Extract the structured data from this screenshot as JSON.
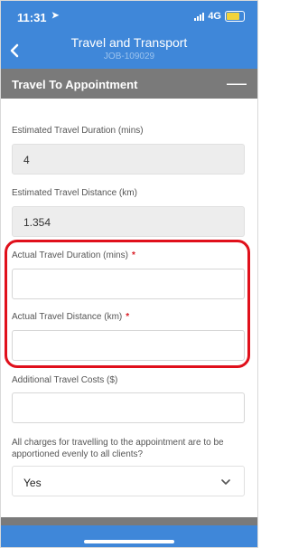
{
  "status_bar": {
    "time": "11:31",
    "network": "4G"
  },
  "header": {
    "title": "Travel and Transport",
    "subtitle": "JOB-109029",
    "back_icon": "chevron-left-icon"
  },
  "section": {
    "title": "Travel To Appointment",
    "collapse_icon": "minus-icon"
  },
  "fields": {
    "est_duration_label": "Estimated Travel Duration (mins)",
    "est_duration_value": "4",
    "est_distance_label": "Estimated Travel Distance (km)",
    "est_distance_value": "1.354",
    "actual_duration_label": "Actual Travel Duration (mins)",
    "actual_distance_label": "Actual Travel Distance (km)",
    "required_mark": "*",
    "additional_costs_label": "Additional Travel Costs ($)",
    "apportion_question": "All charges for travelling to the appointment are to be apportioned evenly to all clients?",
    "apportion_value": "Yes"
  },
  "colors": {
    "header": "#3f87d9",
    "section": "#7a7a7a",
    "required": "#d91a22",
    "highlight": "#e0101b"
  }
}
